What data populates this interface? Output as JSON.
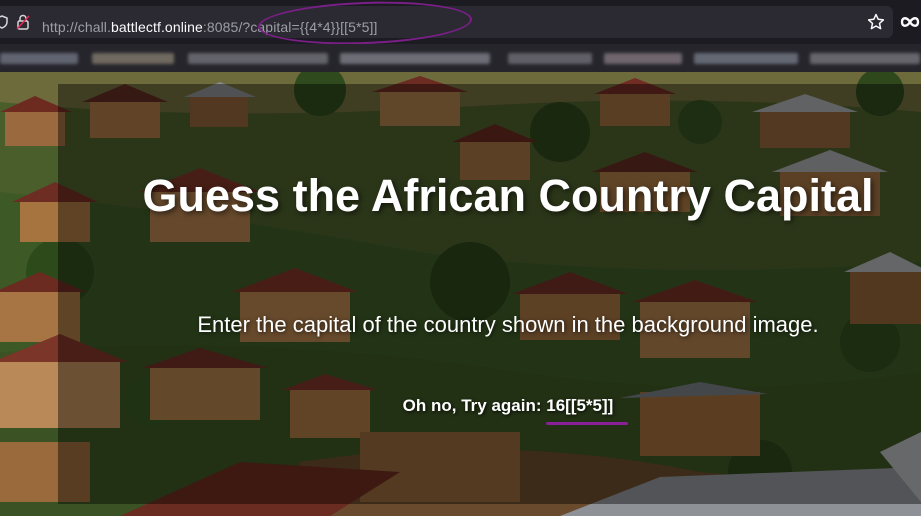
{
  "browser": {
    "url_prefix": "http://chall.",
    "url_host": "battlectf.online",
    "url_suffix": ":8085/?capital={{4*4}}[[5*5]]",
    "icons": [
      "shield-icon",
      "lock-icon",
      "bookmark-star-icon",
      "infinity-extension-icon"
    ],
    "annotation_color": "#7a1f87"
  },
  "page": {
    "title": "Guess the African Country Capital",
    "subtitle": "Enter the capital of the country shown in the background image.",
    "result_message": "Oh no, Try again: 16[[5*5]]"
  }
}
